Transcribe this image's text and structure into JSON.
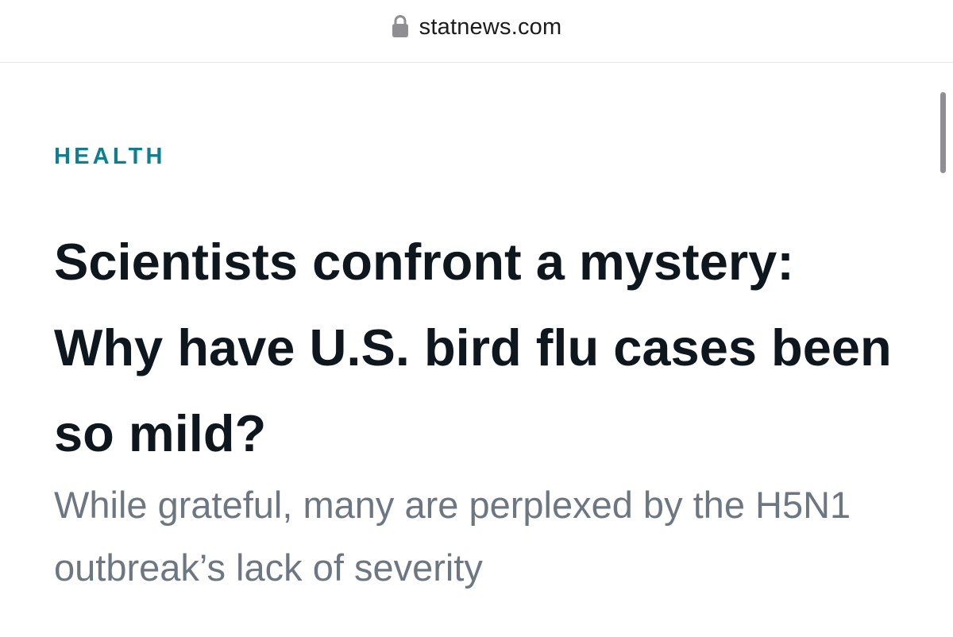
{
  "browser": {
    "url": "statnews.com",
    "lock_icon": "lock-icon"
  },
  "article": {
    "category": "HEALTH",
    "headline": "Scientists confront a mystery: Why have U.S. bird flu cases been so mild?",
    "subheadline": "While grateful, many are perplexed by the H5N1 outbreak’s lack of severity"
  },
  "colors": {
    "category": "#0f7f90",
    "headline": "#0d171d",
    "subheadline": "#6d7781",
    "url_text": "#1c1c1e",
    "scrollbar": "#8e8e93"
  }
}
